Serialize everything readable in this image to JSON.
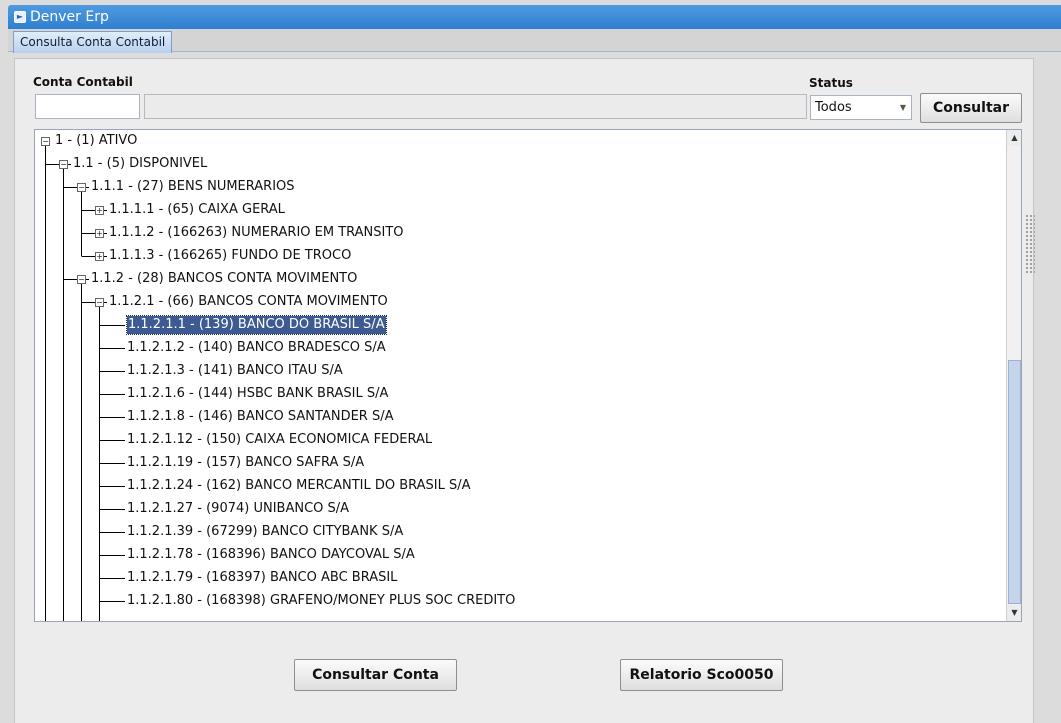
{
  "window": {
    "title": "Denver Erp"
  },
  "tabs": [
    {
      "label": "Consulta Conta Contabil"
    }
  ],
  "form": {
    "conta_label": "Conta Contabil",
    "conta_value": "",
    "descricao_value": "",
    "status_label": "Status",
    "status_value": "Todos",
    "consultar_label": "Consultar"
  },
  "tree": {
    "nodes": [
      {
        "text": "1 - (1) ATIVO",
        "level": 0,
        "toggle": "expanded"
      },
      {
        "text": "1.1 - (5) DISPONIVEL",
        "level": 1,
        "toggle": "expanded"
      },
      {
        "text": "1.1.1 - (27) BENS NUMERARIOS",
        "level": 2,
        "toggle": "expanded"
      },
      {
        "text": "1.1.1.1 - (65) CAIXA GERAL",
        "level": 3,
        "toggle": "collapsed"
      },
      {
        "text": "1.1.1.2 - (166263) NUMERARIO EM TRANSITO",
        "level": 3,
        "toggle": "collapsed"
      },
      {
        "text": "1.1.1.3 - (166265) FUNDO DE TROCO",
        "level": 3,
        "toggle": "collapsed"
      },
      {
        "text": "1.1.2 - (28) BANCOS CONTA MOVIMENTO",
        "level": 2,
        "toggle": "expanded"
      },
      {
        "text": "1.1.2.1 - (66) BANCOS CONTA MOVIMENTO",
        "level": 3,
        "toggle": "expanded"
      },
      {
        "text": "1.1.2.1.1 - (139) BANCO DO BRASIL S/A",
        "level": 4,
        "toggle": "none",
        "selected": true
      },
      {
        "text": "1.1.2.1.2 - (140) BANCO BRADESCO S/A",
        "level": 4,
        "toggle": "none"
      },
      {
        "text": "1.1.2.1.3 - (141) BANCO ITAU S/A",
        "level": 4,
        "toggle": "none"
      },
      {
        "text": "1.1.2.1.6 - (144) HSBC BANK BRASIL S/A",
        "level": 4,
        "toggle": "none"
      },
      {
        "text": "1.1.2.1.8 - (146) BANCO SANTANDER S/A",
        "level": 4,
        "toggle": "none"
      },
      {
        "text": "1.1.2.1.12 - (150) CAIXA ECONOMICA FEDERAL",
        "level": 4,
        "toggle": "none"
      },
      {
        "text": "1.1.2.1.19 - (157) BANCO SAFRA S/A",
        "level": 4,
        "toggle": "none"
      },
      {
        "text": "1.1.2.1.24 - (162) BANCO MERCANTIL DO BRASIL S/A",
        "level": 4,
        "toggle": "none"
      },
      {
        "text": "1.1.2.1.27 - (9074) UNIBANCO S/A",
        "level": 4,
        "toggle": "none"
      },
      {
        "text": "1.1.2.1.39 - (67299) BANCO CITYBANK S/A",
        "level": 4,
        "toggle": "none"
      },
      {
        "text": "1.1.2.1.78 - (168396) BANCO DAYCOVAL S/A",
        "level": 4,
        "toggle": "none"
      },
      {
        "text": "1.1.2.1.79 - (168397) BANCO ABC BRASIL",
        "level": 4,
        "toggle": "none"
      },
      {
        "text": "1.1.2.1.80 - (168398) GRAFENO/MONEY PLUS SOC CREDITO",
        "level": 4,
        "toggle": "none"
      }
    ]
  },
  "scrollbar": {
    "position_fraction": 0.5
  },
  "actions": {
    "consultar_conta_label": "Consultar Conta",
    "relatorio_label": "Relatorio Sco0050"
  }
}
